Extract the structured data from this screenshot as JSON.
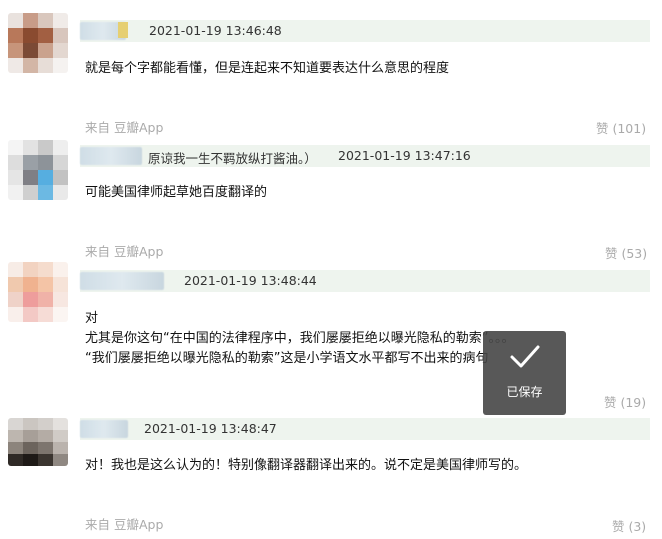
{
  "comments": [
    {
      "time": "2021-01-19 13:46:48",
      "extra": "",
      "lines": [
        "就是每个字都能看懂，但是连起来不知道要表达什么意思的程度"
      ],
      "source": "来自 豆瓣App",
      "votes": "赞 (101)"
    },
    {
      "time": "2021-01-19 13:47:16",
      "extra": "原谅我一生不羁放纵打酱油。）",
      "lines": [
        "可能美国律师起草她百度翻译的"
      ],
      "source": "来自 豆瓣App",
      "votes": "赞 (53)"
    },
    {
      "time": "2021-01-19 13:48:44",
      "extra": "",
      "lines": [
        "对",
        "尤其是你这句“在中国的法律程序中，我们屡屡拒绝以曝光隐私的勒索”。。。",
        "“我们屡屡拒绝以曝光隐私的勒索”这是小学语文水平都写不出来的病句"
      ],
      "source": "来自 豆瓣App",
      "votes": "赞 (19)"
    },
    {
      "time": "2021-01-19 13:48:47",
      "extra": "",
      "lines": [
        "对！我也是这么认为的！特别像翻译器翻译出来的。说不定是美国律师写的。"
      ],
      "source": "来自 豆瓣App",
      "votes": "赞 (3)"
    }
  ],
  "toast": {
    "label": "已保存",
    "icon": "checkmark-icon"
  },
  "colors": {
    "meta_bg": "#eef4ee",
    "muted": "#aaaaaa",
    "toast_bg": "#464646"
  }
}
